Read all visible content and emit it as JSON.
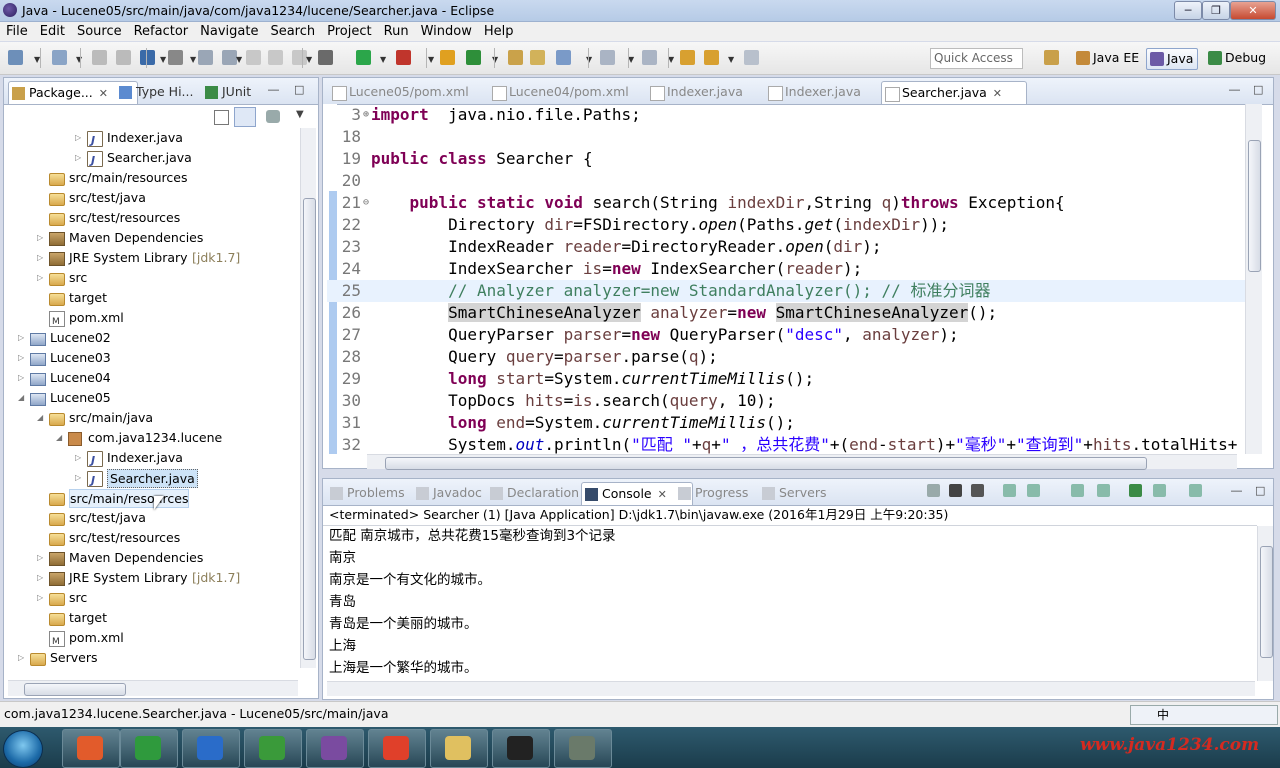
{
  "window": {
    "title": "Java - Lucene05/src/main/java/com/java1234/lucene/Searcher.java - Eclipse"
  },
  "menu": [
    "File",
    "Edit",
    "Source",
    "Refactor",
    "Navigate",
    "Search",
    "Project",
    "Run",
    "Window",
    "Help"
  ],
  "toolbar": {
    "quick_access_placeholder": "Quick Access"
  },
  "perspectives": [
    {
      "label": "Java EE"
    },
    {
      "label": "Java"
    },
    {
      "label": "Debug"
    }
  ],
  "left_tabs": [
    {
      "label": "Package..."
    },
    {
      "label": "Type Hi..."
    },
    {
      "label": "JUnit"
    }
  ],
  "tree": [
    {
      "label": "Indexer.java",
      "depth": 4,
      "icon": "java",
      "twisty": "collapsed"
    },
    {
      "label": "Searcher.java",
      "depth": 4,
      "icon": "java",
      "twisty": "collapsed"
    },
    {
      "label": "src/main/resources",
      "depth": 2,
      "icon": "srcf",
      "twisty": ""
    },
    {
      "label": "src/test/java",
      "depth": 2,
      "icon": "srcf",
      "twisty": ""
    },
    {
      "label": "src/test/resources",
      "depth": 2,
      "icon": "srcf",
      "twisty": ""
    },
    {
      "label": "Maven Dependencies",
      "depth": 2,
      "icon": "lib",
      "twisty": "collapsed"
    },
    {
      "label": "JRE System Library",
      "suffix": "[jdk1.7]",
      "depth": 2,
      "icon": "lib",
      "twisty": "collapsed"
    },
    {
      "label": "src",
      "depth": 2,
      "icon": "folder",
      "twisty": "collapsed"
    },
    {
      "label": "target",
      "depth": 2,
      "icon": "folder",
      "twisty": ""
    },
    {
      "label": "pom.xml",
      "depth": 2,
      "icon": "xml",
      "twisty": ""
    },
    {
      "label": "Lucene02",
      "depth": 1,
      "icon": "proj",
      "twisty": "collapsed"
    },
    {
      "label": "Lucene03",
      "depth": 1,
      "icon": "proj",
      "twisty": "collapsed"
    },
    {
      "label": "Lucene04",
      "depth": 1,
      "icon": "proj",
      "twisty": "collapsed"
    },
    {
      "label": "Lucene05",
      "depth": 1,
      "icon": "proj",
      "twisty": "expanded"
    },
    {
      "label": "src/main/java",
      "depth": 2,
      "icon": "srcf",
      "twisty": "expanded"
    },
    {
      "label": "com.java1234.lucene",
      "depth": 3,
      "icon": "pkg",
      "twisty": "expanded"
    },
    {
      "label": "Indexer.java",
      "depth": 4,
      "icon": "java",
      "twisty": "collapsed"
    },
    {
      "label": "Searcher.java",
      "depth": 4,
      "icon": "java",
      "twisty": "collapsed",
      "selected": true
    },
    {
      "label": "src/main/resources",
      "depth": 2,
      "icon": "srcf",
      "twisty": "",
      "hover": true
    },
    {
      "label": "src/test/java",
      "depth": 2,
      "icon": "srcf",
      "twisty": ""
    },
    {
      "label": "src/test/resources",
      "depth": 2,
      "icon": "srcf",
      "twisty": ""
    },
    {
      "label": "Maven Dependencies",
      "depth": 2,
      "icon": "lib",
      "twisty": "collapsed"
    },
    {
      "label": "JRE System Library",
      "suffix": "[jdk1.7]",
      "depth": 2,
      "icon": "lib",
      "twisty": "collapsed"
    },
    {
      "label": "src",
      "depth": 2,
      "icon": "folder",
      "twisty": "collapsed"
    },
    {
      "label": "target",
      "depth": 2,
      "icon": "folder",
      "twisty": ""
    },
    {
      "label": "pom.xml",
      "depth": 2,
      "icon": "xml",
      "twisty": ""
    },
    {
      "label": "Servers",
      "depth": 1,
      "icon": "folder",
      "twisty": "collapsed"
    }
  ],
  "editor_tabs": [
    {
      "label": "Lucene05/pom.xml",
      "icon": "xml"
    },
    {
      "label": "Lucene04/pom.xml",
      "icon": "xml"
    },
    {
      "label": "Indexer.java",
      "icon": "java"
    },
    {
      "label": "Indexer.java",
      "icon": "java"
    },
    {
      "label": "Searcher.java",
      "icon": "java",
      "active": true
    }
  ],
  "code": [
    {
      "n": "3",
      "fold": "+",
      "tokens": [
        [
          "kw",
          "import"
        ],
        [
          "",
          "  java.nio.file.Paths;"
        ]
      ]
    },
    {
      "n": "18",
      "tokens": []
    },
    {
      "n": "19",
      "tokens": [
        [
          "kw",
          "public"
        ],
        [
          "",
          " "
        ],
        [
          "kw",
          "class"
        ],
        [
          "",
          " Searcher {"
        ]
      ]
    },
    {
      "n": "20",
      "tokens": []
    },
    {
      "n": "21",
      "fold": "-",
      "tokens": [
        [
          "",
          "    "
        ],
        [
          "kw",
          "public"
        ],
        [
          "",
          " "
        ],
        [
          "kw",
          "static"
        ],
        [
          "",
          " "
        ],
        [
          "kw",
          "void"
        ],
        [
          "",
          " search(String "
        ],
        [
          "var",
          "indexDir"
        ],
        [
          "",
          ",String "
        ],
        [
          "var",
          "q"
        ],
        [
          "",
          ")"
        ],
        [
          "kw",
          "throws"
        ],
        [
          "",
          " Exception{"
        ]
      ]
    },
    {
      "n": "22",
      "tokens": [
        [
          "",
          "        Directory "
        ],
        [
          "var",
          "dir"
        ],
        [
          "",
          "=FSDirectory."
        ],
        [
          "it",
          "open"
        ],
        [
          "",
          "(Paths."
        ],
        [
          "it",
          "get"
        ],
        [
          "",
          "("
        ],
        [
          "var",
          "indexDir"
        ],
        [
          "",
          "));"
        ]
      ]
    },
    {
      "n": "23",
      "tokens": [
        [
          "",
          "        IndexReader "
        ],
        [
          "var",
          "reader"
        ],
        [
          "",
          "=DirectoryReader."
        ],
        [
          "it",
          "open"
        ],
        [
          "",
          "("
        ],
        [
          "var",
          "dir"
        ],
        [
          "",
          ");"
        ]
      ]
    },
    {
      "n": "24",
      "tokens": [
        [
          "",
          "        IndexSearcher "
        ],
        [
          "var",
          "is"
        ],
        [
          "",
          "="
        ],
        [
          "kw",
          "new"
        ],
        [
          "",
          " IndexSearcher("
        ],
        [
          "var",
          "reader"
        ],
        [
          "",
          ");"
        ]
      ]
    },
    {
      "n": "25",
      "current": true,
      "tokens": [
        [
          "",
          "        "
        ],
        [
          "cm",
          "// Analyzer analyzer=new StandardAnalyzer(); // 标准分词器"
        ]
      ]
    },
    {
      "n": "26",
      "tokens": [
        [
          "",
          "        "
        ],
        [
          "hl",
          "SmartChineseAnalyzer"
        ],
        [
          "",
          " "
        ],
        [
          "var",
          "analyzer"
        ],
        [
          "",
          "="
        ],
        [
          "kw",
          "new"
        ],
        [
          "",
          " "
        ],
        [
          "hl",
          "SmartChineseAnalyzer"
        ],
        [
          "",
          "();"
        ]
      ]
    },
    {
      "n": "27",
      "tokens": [
        [
          "",
          "        QueryParser "
        ],
        [
          "var",
          "parser"
        ],
        [
          "",
          "="
        ],
        [
          "kw",
          "new"
        ],
        [
          "",
          " QueryParser("
        ],
        [
          "st",
          "\"desc\""
        ],
        [
          "",
          ", "
        ],
        [
          "var",
          "analyzer"
        ],
        [
          "",
          ");"
        ]
      ]
    },
    {
      "n": "28",
      "tokens": [
        [
          "",
          "        Query "
        ],
        [
          "var",
          "query"
        ],
        [
          "",
          "="
        ],
        [
          "var",
          "parser"
        ],
        [
          "",
          ".parse("
        ],
        [
          "var",
          "q"
        ],
        [
          "",
          ");"
        ]
      ]
    },
    {
      "n": "29",
      "tokens": [
        [
          "",
          "        "
        ],
        [
          "kw",
          "long"
        ],
        [
          "",
          " "
        ],
        [
          "var",
          "start"
        ],
        [
          "",
          "=System."
        ],
        [
          "it",
          "currentTimeMillis"
        ],
        [
          "",
          "();"
        ]
      ]
    },
    {
      "n": "30",
      "tokens": [
        [
          "",
          "        TopDocs "
        ],
        [
          "var",
          "hits"
        ],
        [
          "",
          "="
        ],
        [
          "var",
          "is"
        ],
        [
          "",
          ".search("
        ],
        [
          "var",
          "query"
        ],
        [
          "",
          ", 10);"
        ]
      ]
    },
    {
      "n": "31",
      "tokens": [
        [
          "",
          "        "
        ],
        [
          "kw",
          "long"
        ],
        [
          "",
          " "
        ],
        [
          "var",
          "end"
        ],
        [
          "",
          "=System."
        ],
        [
          "it",
          "currentTimeMillis"
        ],
        [
          "",
          "();"
        ]
      ]
    },
    {
      "n": "32",
      "tokens": [
        [
          "",
          "        System."
        ],
        [
          "fld",
          "out"
        ],
        [
          "",
          ".println("
        ],
        [
          "st",
          "\"匹配 \""
        ],
        [
          "",
          "+"
        ],
        [
          "var",
          "q"
        ],
        [
          "",
          "+"
        ],
        [
          "st",
          "\" ，总共花费\""
        ],
        [
          "",
          "+("
        ],
        [
          "var",
          "end"
        ],
        [
          "",
          "-"
        ],
        [
          "var",
          "start"
        ],
        [
          "",
          ")+"
        ],
        [
          "st",
          "\"毫秒\""
        ],
        [
          "",
          "+"
        ],
        [
          "st",
          "\"查询到\""
        ],
        [
          "",
          "+"
        ],
        [
          "var",
          "hits"
        ],
        [
          "",
          ".totalHits+"
        ]
      ]
    }
  ],
  "console_tabs": [
    {
      "label": "Problems"
    },
    {
      "label": "Javadoc"
    },
    {
      "label": "Declaration"
    },
    {
      "label": "Console",
      "active": true
    },
    {
      "label": "Progress"
    },
    {
      "label": "Servers"
    }
  ],
  "console": {
    "header": "<terminated> Searcher (1) [Java Application] D:\\jdk1.7\\bin\\javaw.exe (2016年1月29日 上午9:20:35)",
    "lines": [
      "匹配 南京城市，总共花费15毫秒查询到3个记录",
      "南京",
      "南京是一个有文化的城市。",
      "青岛",
      "青岛是一个美丽的城市。",
      "上海",
      "上海是一个繁华的城市。"
    ]
  },
  "status": {
    "text": "com.java1234.lucene.Searcher.java - Lucene05/src/main/java"
  },
  "ime": {
    "label": "中"
  },
  "watermark": {
    "text": "www.java1234.com"
  },
  "colors": {
    "keyword": "#7f0055",
    "string": "#2a00ff",
    "comment": "#3f7f5f",
    "taskbar": "#1b3c4b"
  }
}
